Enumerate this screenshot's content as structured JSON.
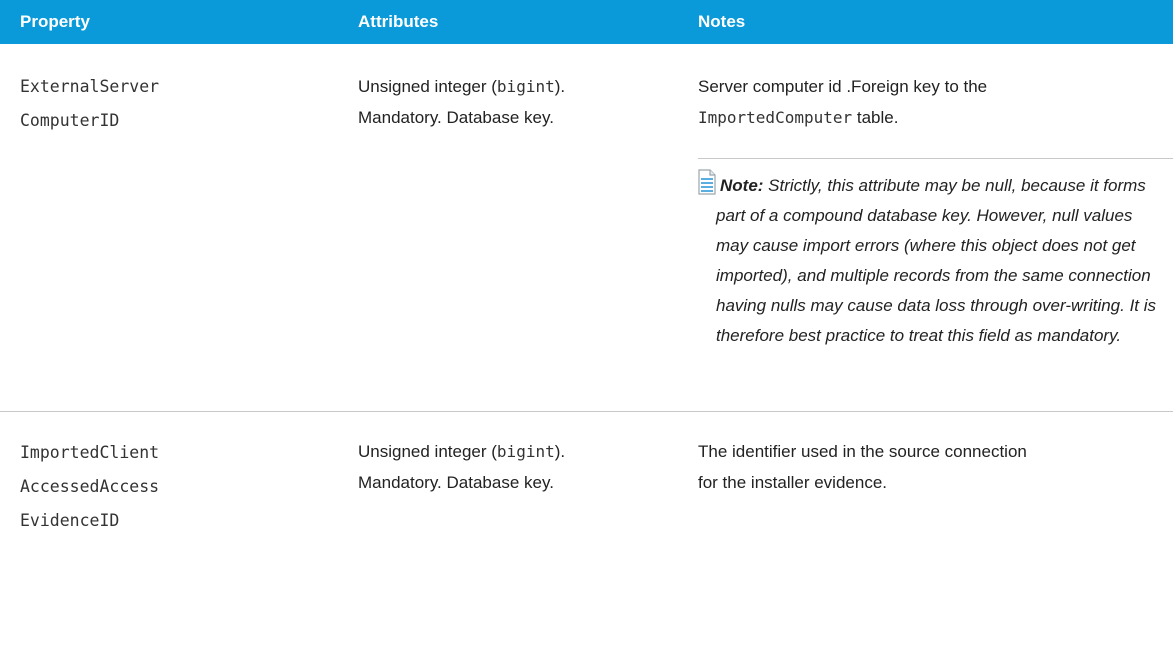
{
  "table": {
    "headers": {
      "property": "Property",
      "attributes": "Attributes",
      "notes": "Notes"
    },
    "rows": [
      {
        "property_lines": [
          "ExternalServer",
          "ComputerID"
        ],
        "attributes": {
          "line1_pre": "Unsigned integer (",
          "line1_code": "bigint",
          "line1_post": ").",
          "line2": "Mandatory. Database key."
        },
        "notes": {
          "line1": "Server computer id .Foreign key to the",
          "line2_code": "ImportedComputer",
          "line2_post": " table."
        },
        "note": {
          "icon": "note-icon",
          "label": "Note:",
          "text": " Strictly, this attribute may be null, because it forms part of a compound database key. However, null values may cause import errors (where this object does not get imported), and multiple records from the same connection having nulls may cause data loss through over-writing. It is therefore best practice to treat this field as mandatory."
        }
      },
      {
        "property_lines": [
          "ImportedClient",
          "AccessedAccess",
          "EvidenceID"
        ],
        "attributes": {
          "line1_pre": "Unsigned integer (",
          "line1_code": "bigint",
          "line1_post": ").",
          "line2": "Mandatory. Database key."
        },
        "notes": {
          "line1": "The identifier used in the source connection",
          "line2": "for the installer evidence."
        }
      }
    ]
  },
  "colors": {
    "header_bg": "#0a9ad9",
    "header_text": "#ffffff",
    "divider": "#c8c8c8",
    "note_icon": "#5aaee0"
  }
}
